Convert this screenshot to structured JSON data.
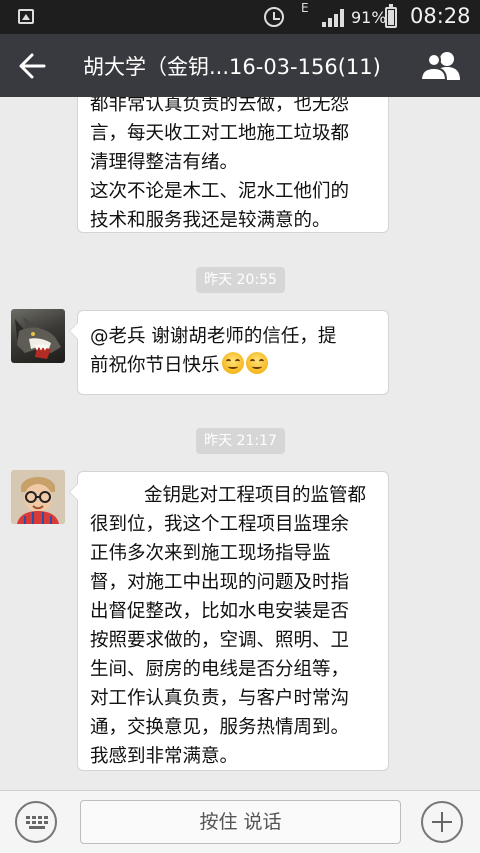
{
  "status_bar": {
    "network_type": "E",
    "battery_percent": "91%",
    "time": "08:28",
    "icons": [
      "gallery-icon",
      "alarm-icon",
      "signal-icon",
      "battery-icon"
    ]
  },
  "header": {
    "title": "胡大学（金钥...16-03-156(11)",
    "back_icon": "arrow-left-icon",
    "members_icon": "group-members-icon"
  },
  "messages": [
    {
      "type": "text",
      "lines": [
        "都非常认真负责的去做，也无怨",
        "言，每天收工对工地施工垃圾都",
        "清理得整洁有绪。",
        "这次不论是木工、泥水工他们的",
        "技术和服务我还是较满意的。"
      ]
    },
    {
      "type": "timestamp",
      "text": "昨天 20:55"
    },
    {
      "type": "text",
      "avatar": "wolf-avatar",
      "lines": [
        "@老兵 谢谢胡老师的信任，提",
        "前祝你节日快乐"
      ],
      "emoji": [
        "smile-emoji",
        "smile-emoji"
      ]
    },
    {
      "type": "timestamp",
      "text": "昨天 21:17"
    },
    {
      "type": "text",
      "avatar": "child-avatar",
      "lines": [
        "金钥匙对工程项目的监管都",
        "很到位，我这个工程项目监理余",
        "正伟多次来到施工现场指导监",
        "督，对施工中出现的问题及时指",
        "出督促整改，比如水电安装是否",
        "按照要求做的，空调、照明、卫",
        "生间、厨房的电线是否分组等，",
        "对工作认真负责，与客户时常沟",
        "通，交换意见，服务热情周到。",
        "我感到非常满意。"
      ]
    }
  ],
  "input_bar": {
    "keyboard_icon": "keyboard-icon",
    "hold_to_talk_label": "按住 说话",
    "plus_icon": "plus-icon"
  },
  "colors": {
    "status_bar_bg": "#1e1e1e",
    "title_bar_bg": "#393a3f",
    "chat_bg": "#ebebeb",
    "bubble_bg": "#ffffff",
    "timestamp_bg": "#d6d6d6"
  }
}
